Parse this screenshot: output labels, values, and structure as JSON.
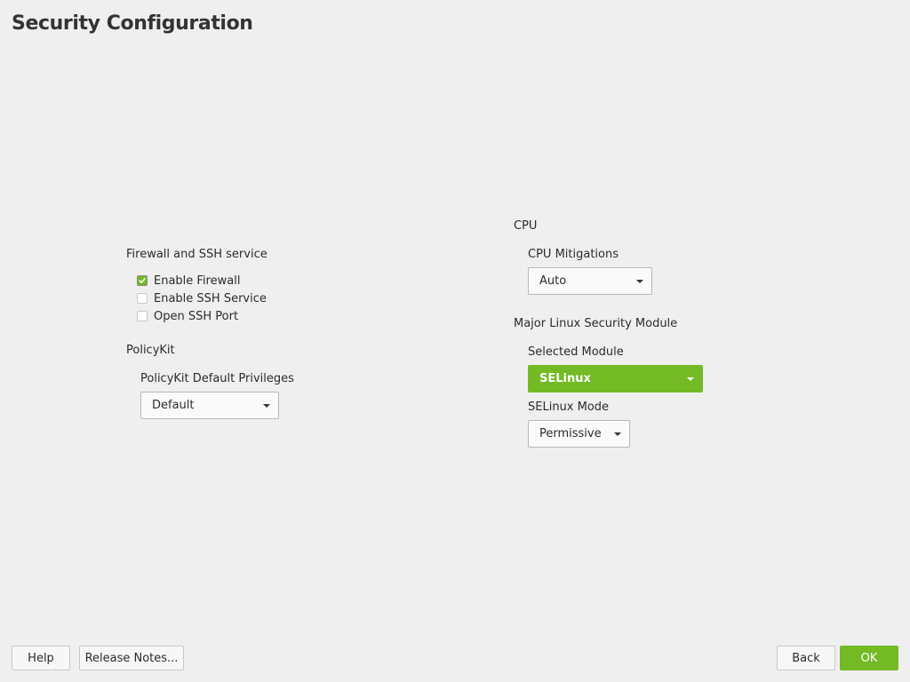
{
  "page": {
    "title": "Security Configuration"
  },
  "firewall": {
    "heading": "Firewall and SSH service",
    "options": [
      {
        "label": "Enable Firewall",
        "checked": true
      },
      {
        "label": "Enable SSH Service",
        "checked": false
      },
      {
        "label": "Open SSH Port",
        "checked": false
      }
    ]
  },
  "policykit": {
    "heading": "PolicyKit",
    "field_label": "PolicyKit Default Privileges",
    "value": "Default"
  },
  "cpu": {
    "heading": "CPU",
    "field_label": "CPU Mitigations",
    "value": "Auto"
  },
  "lsm": {
    "heading": "Major Linux Security Module",
    "module_label": "Selected Module",
    "module_value": "SELinux",
    "mode_label": "SELinux Mode",
    "mode_value": "Permissive"
  },
  "footer": {
    "help": "Help",
    "release_notes": "Release Notes...",
    "back": "Back",
    "ok": "OK"
  },
  "colors": {
    "accent": "#73ba25",
    "background": "#efefef"
  },
  "icons": {
    "checkmark": "check-icon",
    "dropdown": "chevron-down-icon"
  }
}
